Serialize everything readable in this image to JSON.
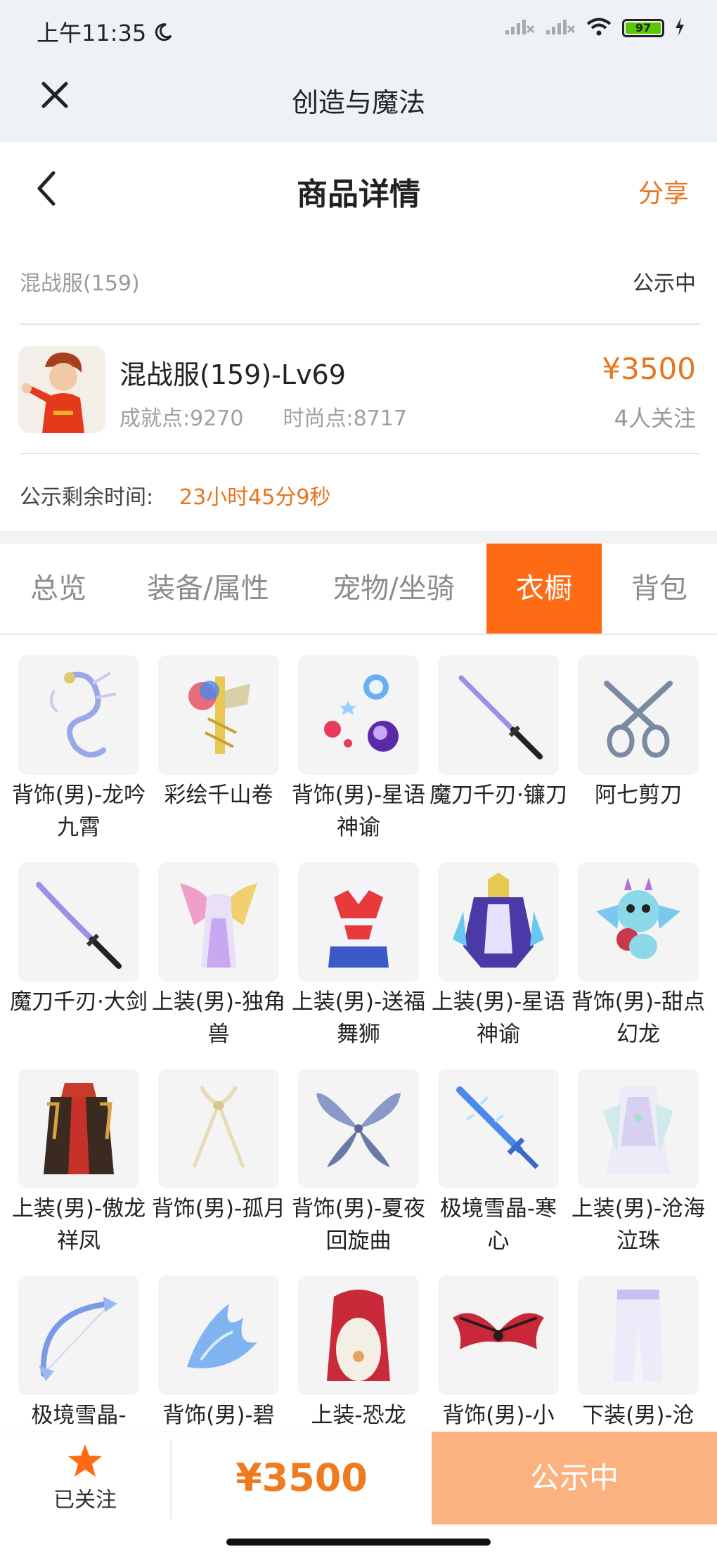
{
  "status_bar": {
    "time": "上午11:35",
    "battery": "97"
  },
  "app_bar": {
    "title": "创造与魔法"
  },
  "detail": {
    "title": "商品详情",
    "share": "分享",
    "server": "混战服(159)",
    "state": "公示中"
  },
  "product": {
    "name": "混战服(159)-Lv69",
    "achievement": "成就点:9270",
    "fashion": "时尚点:8717",
    "price": "¥3500",
    "watchers": "4人关注"
  },
  "countdown": {
    "label": "公示剩余时间:",
    "value": "23小时45分9秒"
  },
  "tabs": [
    {
      "label": "总览"
    },
    {
      "label": "装备/属性"
    },
    {
      "label": "宠物/坐骑"
    },
    {
      "label": "衣橱",
      "active": true
    },
    {
      "label": "背包"
    }
  ],
  "wardrobe": [
    {
      "label": "背饰(男)-龙吟九霄"
    },
    {
      "label": "彩绘千山卷"
    },
    {
      "label": "背饰(男)-星语神谕"
    },
    {
      "label": "魔刀千刃·镰刀"
    },
    {
      "label": "阿七剪刀"
    },
    {
      "label": "魔刀千刃·大剑"
    },
    {
      "label": "上装(男)-独角兽"
    },
    {
      "label": "上装(男)-送福舞狮"
    },
    {
      "label": "上装(男)-星语神谕"
    },
    {
      "label": "背饰(男)-甜点幻龙"
    },
    {
      "label": "上装(男)-傲龙祥凤"
    },
    {
      "label": "背饰(男)-孤月"
    },
    {
      "label": "背饰(男)-夏夜回旋曲"
    },
    {
      "label": "极境雪晶-寒心"
    },
    {
      "label": "上装(男)-沧海泣珠"
    },
    {
      "label": "极境雪晶-"
    },
    {
      "label": "背饰(男)-碧"
    },
    {
      "label": "上装-恐龙"
    },
    {
      "label": "背饰(男)-小"
    },
    {
      "label": "下装(男)-沧"
    }
  ],
  "bottom_bar": {
    "follow_label": "已关注",
    "price": "¥3500",
    "action": "公示中"
  },
  "colors": {
    "accent": "#ff6a14",
    "price": "#e8741e",
    "action_bg": "#fbb280"
  }
}
